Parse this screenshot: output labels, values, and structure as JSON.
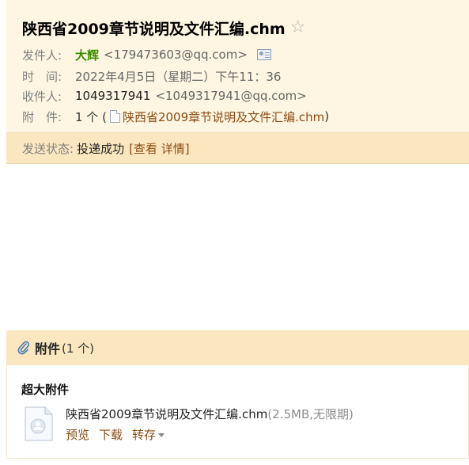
{
  "subject": "陕西省2009章节说明及文件汇编.chm",
  "star_icon": "star-outline-icon",
  "sender": {
    "label": "发件人:",
    "name": "大辉",
    "address": "<179473603@qq.com>"
  },
  "time": {
    "label": "时　间:",
    "value": "2022年4月5日（星期二）下午11：36"
  },
  "recipient": {
    "label": "收件人:",
    "name": "1049317941",
    "address": "<1049317941@qq.com>"
  },
  "attachment_line": {
    "label": "附　件:",
    "count": "1 个 (",
    "file": "陕西省2009章节说明及文件汇编.chm",
    "close": ")"
  },
  "send_status": {
    "label": "发送状态:",
    "value": "投递成功",
    "detail": "[查看 详情]"
  },
  "attachments_panel": {
    "title": "附件",
    "count": "(1 个)",
    "section_title": "超大附件",
    "file": {
      "name": "陕西省2009章节说明及文件汇编.chm",
      "meta": "(2.5MB,无限期)",
      "actions": {
        "preview": "预览",
        "download": "下载",
        "save": "转存"
      }
    }
  },
  "colors": {
    "header_bg": "#fef6e2",
    "status_bg": "#fbe7bf",
    "sender_green": "#3a8d00",
    "link_brown": "#8a4b14"
  }
}
